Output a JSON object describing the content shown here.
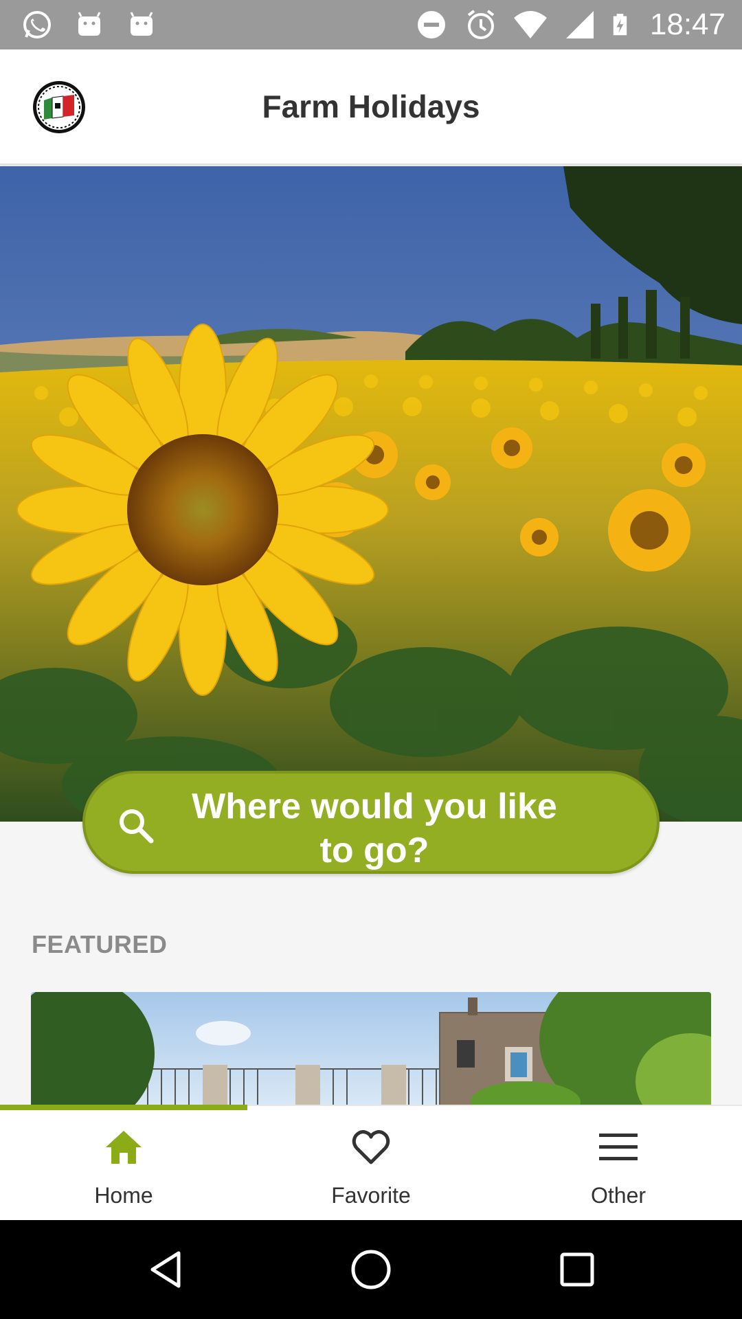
{
  "status_bar": {
    "time": "18:47",
    "left_icons": [
      "whatsapp-icon",
      "android-icon",
      "android-icon"
    ],
    "right_icons": [
      "do-not-disturb-icon",
      "alarm-icon",
      "wifi-icon",
      "signal-icon",
      "battery-charging-icon"
    ]
  },
  "app_bar": {
    "title": "Farm Holidays",
    "logo": "italian-flag-logo"
  },
  "search": {
    "label": "Where would you like to go?",
    "icon": "search-icon"
  },
  "featured": {
    "section_label": "FEATURED"
  },
  "bottom_nav": {
    "items": [
      {
        "label": "Home",
        "icon": "home-icon",
        "active": true
      },
      {
        "label": "Favorite",
        "icon": "heart-icon",
        "active": false
      },
      {
        "label": "Other",
        "icon": "menu-icon",
        "active": false
      }
    ]
  },
  "system_nav": {
    "buttons": [
      "back-icon",
      "home-circle-icon",
      "recents-icon"
    ]
  },
  "colors": {
    "accent": "#93ae22",
    "active_nav": "#8bab17",
    "status_bar": "#9a9a9a"
  }
}
